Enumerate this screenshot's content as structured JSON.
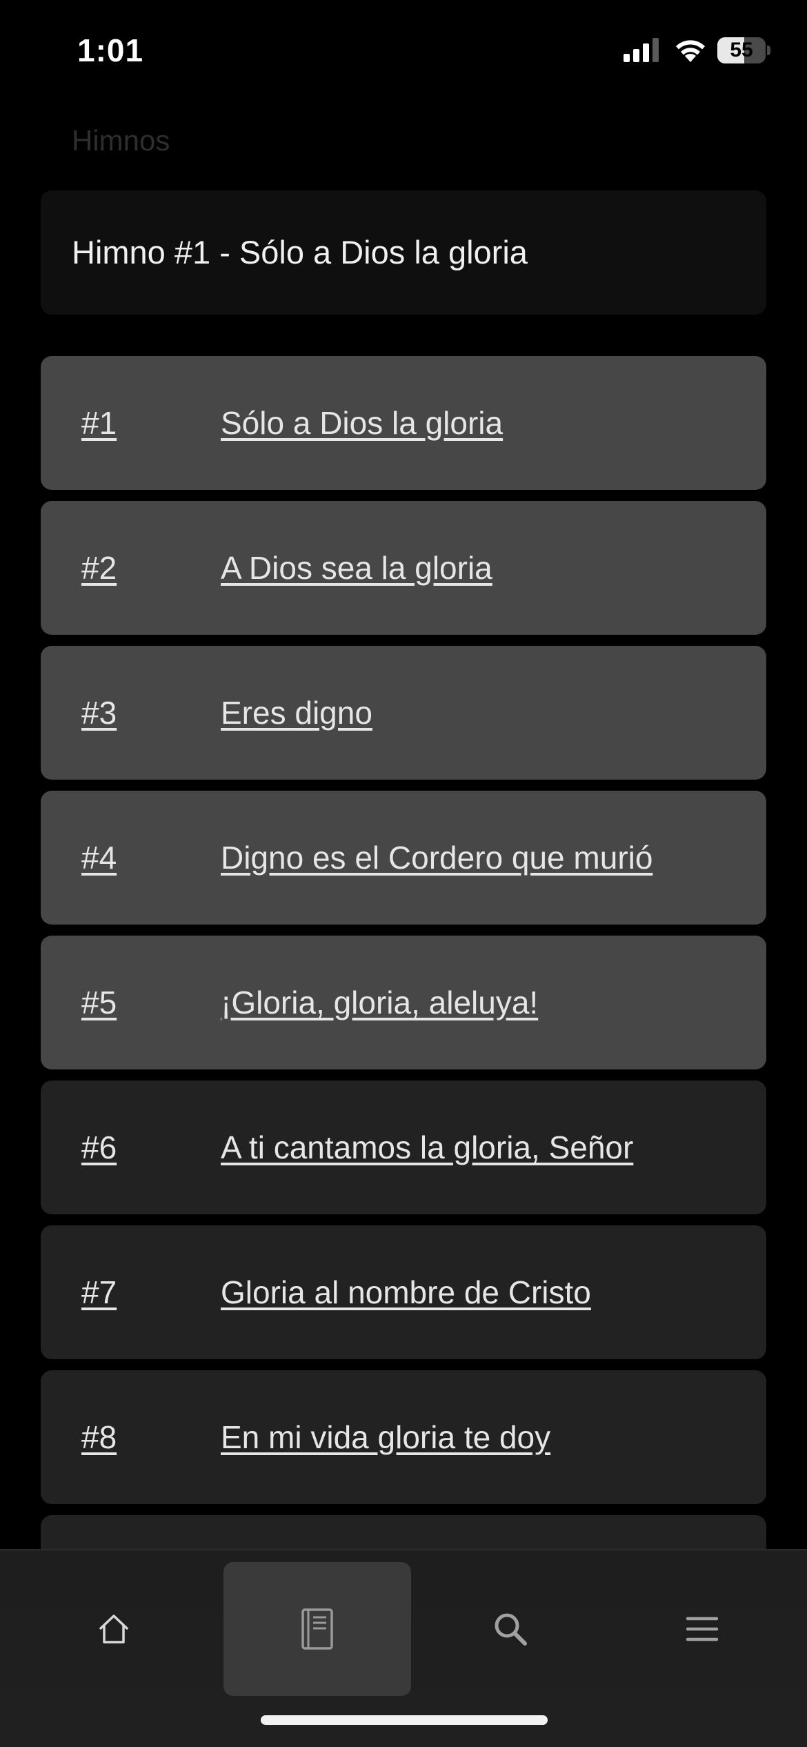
{
  "status_bar": {
    "time": "1:01",
    "battery_level": "55",
    "battery_fraction": 0.55,
    "icons": [
      "signal-icon",
      "wifi-icon",
      "battery-icon"
    ]
  },
  "header": {
    "title": "Himnos",
    "current_hymn": "Himno #1 - Sólo a Dios la gloria"
  },
  "hymns": [
    {
      "number": "#1",
      "title": "Sólo a Dios la gloria",
      "highlighted": true
    },
    {
      "number": "#2",
      "title": "A Dios sea la gloria",
      "highlighted": true
    },
    {
      "number": "#3",
      "title": "Eres digno",
      "highlighted": true
    },
    {
      "number": "#4",
      "title": "Digno es el Cordero que murió",
      "highlighted": true
    },
    {
      "number": "#5",
      "title": "¡Gloria, gloria, aleluya!",
      "highlighted": true
    },
    {
      "number": "#6",
      "title": "A ti cantamos la gloria, Señor",
      "highlighted": false
    },
    {
      "number": "#7",
      "title": "Gloria al nombre de Cristo",
      "highlighted": false
    },
    {
      "number": "#8",
      "title": "En mi vida gloria te doy",
      "highlighted": false
    },
    {
      "number": "",
      "title": "",
      "highlighted": false
    }
  ],
  "bottom_nav": {
    "items": [
      {
        "icon": "home-icon",
        "active": false
      },
      {
        "icon": "hymnal-book-icon",
        "active": true
      },
      {
        "icon": "search-icon",
        "active": false
      },
      {
        "icon": "menu-icon",
        "active": false
      }
    ]
  },
  "colors": {
    "background": "#000000",
    "row_highlight": "#474747",
    "row_default": "#222222",
    "text": "#e6e6e6"
  }
}
